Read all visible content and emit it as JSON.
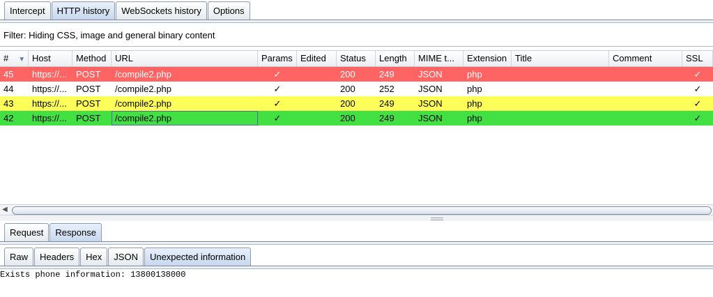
{
  "main_tabs": [
    "Intercept",
    "HTTP history",
    "WebSockets history",
    "Options"
  ],
  "main_tab_active": "HTTP history",
  "filter": {
    "text": "Filter: Hiding CSS, image and general binary content"
  },
  "table": {
    "columns": [
      "#",
      "Host",
      "Method",
      "URL",
      "Params",
      "Edited",
      "Status",
      "Length",
      "MIME t...",
      "Extension",
      "Title",
      "Comment",
      "SSL"
    ],
    "sort_icon": "sort-down-icon",
    "rows": [
      {
        "num": "45",
        "host": "https://...",
        "method": "POST",
        "url": "/compile2.php",
        "params": "✓",
        "edited": "",
        "status": "200",
        "length": "249",
        "mime": "JSON",
        "ext": "php",
        "title": "",
        "comment": "",
        "ssl": "✓",
        "highlight": "#ff6464"
      },
      {
        "num": "44",
        "host": "https://...",
        "method": "POST",
        "url": "/compile2.php",
        "params": "✓",
        "edited": "",
        "status": "200",
        "length": "252",
        "mime": "JSON",
        "ext": "php",
        "title": "",
        "comment": "",
        "ssl": "✓",
        "highlight": "#ffffff"
      },
      {
        "num": "43",
        "host": "https://...",
        "method": "POST",
        "url": "/compile2.php",
        "params": "✓",
        "edited": "",
        "status": "200",
        "length": "249",
        "mime": "JSON",
        "ext": "php",
        "title": "",
        "comment": "",
        "ssl": "✓",
        "highlight": "#ffff5a"
      },
      {
        "num": "42",
        "host": "https://...",
        "method": "POST",
        "url": "/compile2.php",
        "params": "✓",
        "edited": "",
        "status": "200",
        "length": "249",
        "mime": "JSON",
        "ext": "php",
        "title": "",
        "comment": "",
        "ssl": "✓",
        "highlight": "#43e043"
      }
    ]
  },
  "detail_tabs": [
    "Request",
    "Response"
  ],
  "detail_tab_active": "Response",
  "view_tabs": [
    "Raw",
    "Headers",
    "Hex",
    "JSON",
    "Unexpected information"
  ],
  "view_tab_active": "Unexpected information",
  "response_body": "Exists phone information: 13800138000"
}
